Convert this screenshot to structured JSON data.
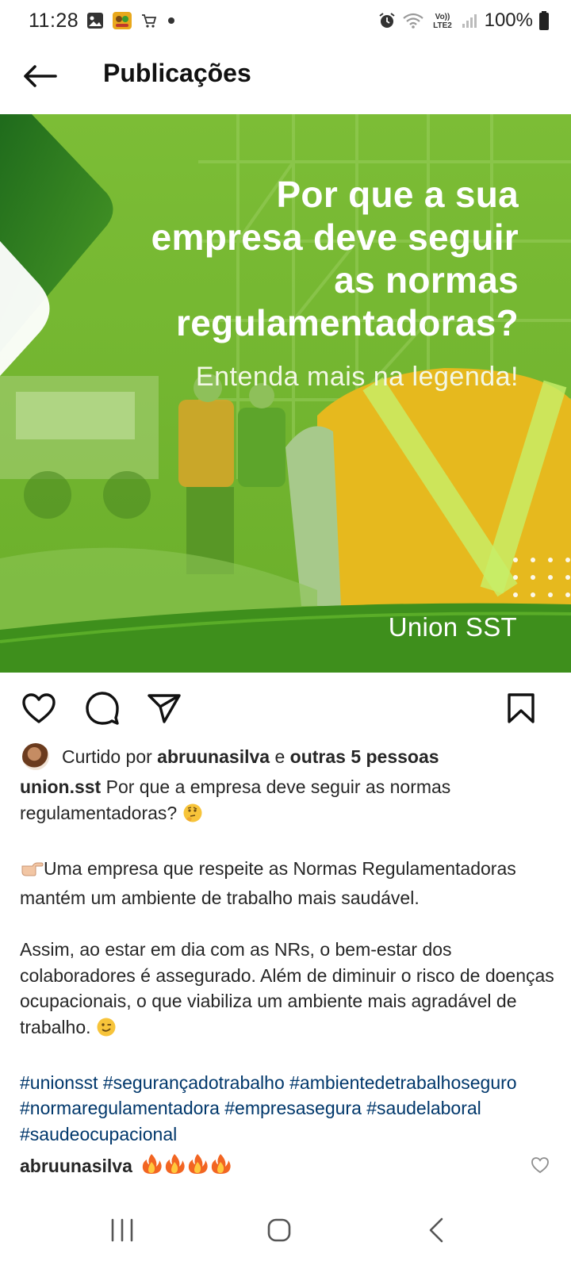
{
  "status_bar": {
    "time": "11:28",
    "battery": "100%",
    "volte_label": "Vo))\nLTE2",
    "icons": [
      "gallery-icon",
      "game-icon",
      "shopping-cart-icon",
      "dot-icon",
      "alarm-icon",
      "wifi-icon",
      "volte-icon",
      "signal-icon",
      "battery-icon"
    ]
  },
  "header": {
    "title": "Publicações",
    "back_icon": "arrow-left-icon"
  },
  "post": {
    "image": {
      "headline_lines": [
        "Por que a sua",
        "empresa deve seguir",
        "as normas",
        "regulamentadoras?"
      ],
      "subline": "Entenda mais na legenda!",
      "brand": "Union SST",
      "colors": {
        "overlay": "#6fb52c",
        "dark_green": "#2e7d1e",
        "vest": "#e8b81a"
      }
    },
    "actions": {
      "like_icon": "heart-outline-icon",
      "comment_icon": "comment-icon",
      "share_icon": "send-icon",
      "save_icon": "bookmark-outline-icon"
    },
    "likes": {
      "prefix": "Curtido por ",
      "user": "abruunasilva",
      "conjunction": " e ",
      "others": "outras 5 pessoas"
    },
    "caption": {
      "username": "union.sst",
      "line1_text": " Por que a empresa deve seguir as normas regulamentadoras? ",
      "emoji1": "thinking-face-emoji",
      "para2_emoji": "pointing-right-emoji",
      "para2": "Uma empresa que respeite as Normas Regulamentadoras mantém um ambiente de trabalho mais saudável.",
      "para3": "Assim, ao estar em dia com as NRs, o bem-estar dos colaboradores é assegurado. Além de diminuir o risco de doenças ocupacionais, o que viabiliza um ambiente mais agradável de trabalho. ",
      "emoji3": "winking-face-emoji",
      "hashtags": "#unionsst #segurançadotrabalho #ambientedetrabalhoseguro #normaregulamentadora #empresasegura #saudelaboral #saudeocupacional"
    },
    "comment": {
      "user": "abruunasilva",
      "emojis": [
        "fire-emoji",
        "fire-emoji",
        "fire-emoji",
        "fire-emoji"
      ]
    }
  },
  "navbar": {
    "recent_icon": "recent-apps-icon",
    "home_icon": "home-icon",
    "back_icon": "back-chevron-icon"
  }
}
